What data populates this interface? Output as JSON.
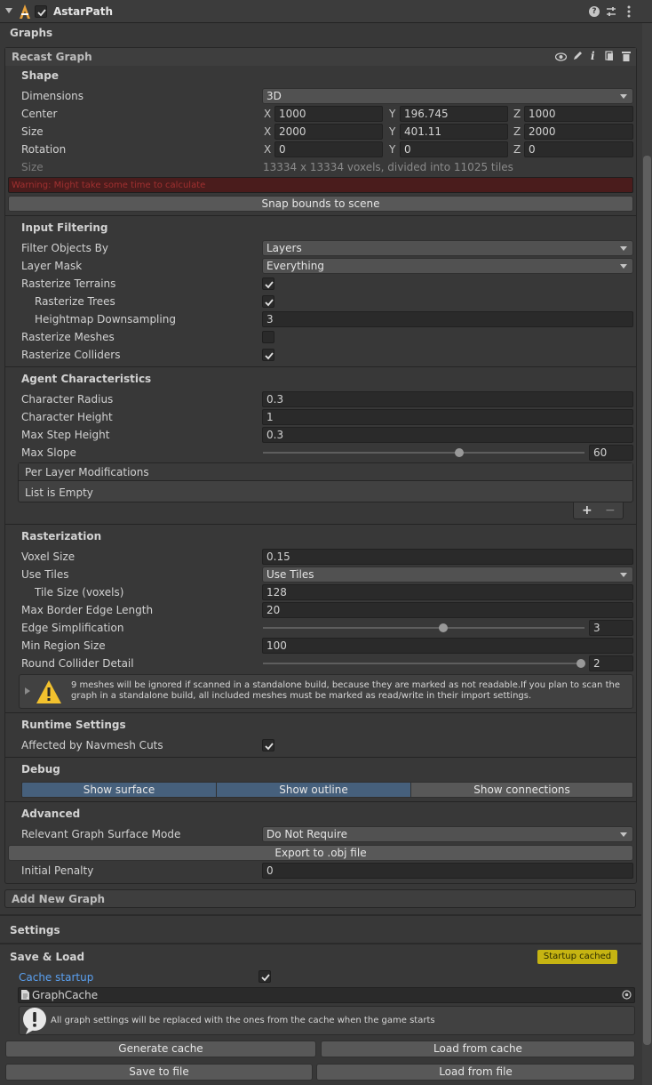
{
  "header": {
    "title": "AstarPath",
    "enabled": true
  },
  "graphs_label": "Graphs",
  "recast": {
    "title": "Recast Graph",
    "shape": {
      "heading": "Shape",
      "dimensions_label": "Dimensions",
      "dimensions_value": "3D",
      "center_label": "Center",
      "center": {
        "x": "1000",
        "y": "196.745",
        "z": "1000"
      },
      "size_label": "Size",
      "size": {
        "x": "2000",
        "y": "401.11",
        "z": "2000"
      },
      "rotation_label": "Rotation",
      "rotation": {
        "x": "0",
        "y": "0",
        "z": "0"
      },
      "voxel_size_label": "Size",
      "voxel_info": "13334 x 13334 voxels, divided into 11025 tiles",
      "warning": "Warning: Might take some time to calculate",
      "snap_button": "Snap bounds to scene"
    },
    "axes": {
      "x": "X",
      "y": "Y",
      "z": "Z"
    },
    "input": {
      "heading": "Input Filtering",
      "filter_label": "Filter Objects By",
      "filter_value": "Layers",
      "mask_label": "Layer Mask",
      "mask_value": "Everything",
      "terrains_label": "Rasterize Terrains",
      "terrains": true,
      "trees_label": "Rasterize Trees",
      "trees": true,
      "heightmap_label": "Heightmap Downsampling",
      "heightmap_value": "3",
      "meshes_label": "Rasterize Meshes",
      "meshes": false,
      "colliders_label": "Rasterize Colliders",
      "colliders": true
    },
    "agent": {
      "heading": "Agent Characteristics",
      "radius_label": "Character Radius",
      "radius": "0.3",
      "height_label": "Character Height",
      "height": "1",
      "step_label": "Max Step Height",
      "step": "0.3",
      "slope_label": "Max Slope",
      "slope": "60",
      "slope_fraction": 0.61,
      "per_layer_label": "Per Layer Modifications",
      "list_empty": "List is Empty",
      "add": "+",
      "remove": "−"
    },
    "raster": {
      "heading": "Rasterization",
      "voxel_label": "Voxel Size",
      "voxel": "0.15",
      "tiles_label": "Use Tiles",
      "tiles": "Use Tiles",
      "tile_size_label": "Tile Size (voxels)",
      "tile_size": "128",
      "border_label": "Max Border Edge Length",
      "border": "20",
      "simp_label": "Edge Simplification",
      "simp": "3",
      "simp_fraction": 0.56,
      "region_label": "Min Region Size",
      "region": "100",
      "round_label": "Round Collider Detail",
      "round": "2",
      "round_fraction": 0.99,
      "note": "9 meshes will be ignored if scanned in a standalone build, because they are marked as not readable.If you plan to scan the graph in a standalone build, all included meshes must be marked as read/write in their import settings."
    },
    "runtime": {
      "heading": "Runtime Settings",
      "cuts_label": "Affected by Navmesh Cuts",
      "cuts": true
    },
    "debug": {
      "heading": "Debug",
      "surface": "Show surface",
      "outline": "Show outline",
      "connections": "Show connections"
    },
    "advanced": {
      "heading": "Advanced",
      "surface_mode_label": "Relevant Graph Surface Mode",
      "surface_mode": "Do Not Require",
      "export_button": "Export to .obj file",
      "penalty_label": "Initial Penalty",
      "penalty": "0"
    }
  },
  "add_graph": "Add New Graph",
  "settings": "Settings",
  "save_load": {
    "heading": "Save & Load",
    "badge": "Startup cached",
    "cache_startup_label": "Cache startup",
    "cache_startup": true,
    "asset": "GraphCache",
    "info": "All graph settings will be replaced with the ones from the cache when the game starts",
    "generate": "Generate cache",
    "load_cache": "Load from cache",
    "save_file": "Save to file",
    "load_file": "Load from file"
  },
  "colors": {
    "accent_link": "#5aa0f0",
    "badge_bg": "#c6b412",
    "debug_active": "#46607c",
    "warning_bg": "#4a1c1c"
  }
}
